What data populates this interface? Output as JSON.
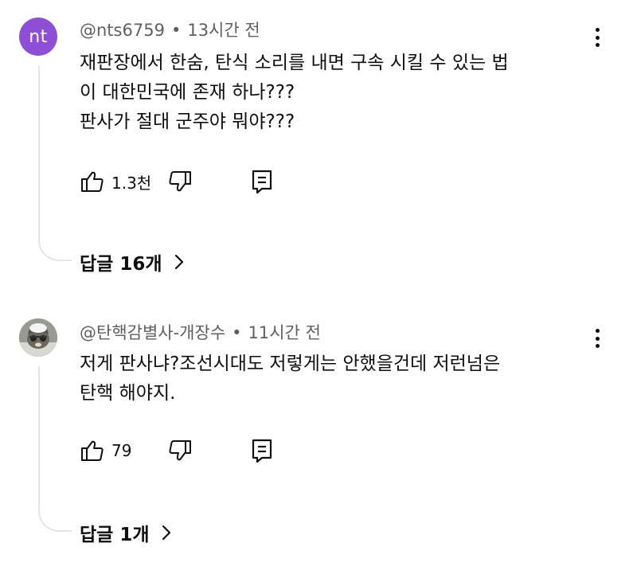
{
  "comments": [
    {
      "avatar_text": "nt",
      "avatar_color": "#8e4fd6",
      "author": "@nts6759",
      "separator": "•",
      "time": "13시간 전",
      "text": "재판장에서 한숨, 탄식 소리를 내면 구속 시킬 수 있는 법\n이 대한민국에 존재 하나???\n판사가 절대 군주야 뭐야???",
      "likes": "1.3천",
      "replies_label": "답글 16개",
      "icons": {
        "like": "thumb-up-icon",
        "dislike": "thumb-down-icon",
        "reply": "reply-icon",
        "more": "more-vert-icon",
        "chevron": "chevron-right-icon"
      }
    },
    {
      "avatar_text": "",
      "avatar_color": "#8a8a80",
      "author": "@탄핵감별사-개장수",
      "separator": "•",
      "time": "11시간 전",
      "text": "저게 판사냐?조선시대도 저렇게는 안했을건데 저런넘은\n탄핵 해야지.",
      "likes": "79",
      "replies_label": "답글 1개",
      "icons": {
        "like": "thumb-up-icon",
        "dislike": "thumb-down-icon",
        "reply": "reply-icon",
        "more": "more-vert-icon",
        "chevron": "chevron-right-icon"
      }
    }
  ]
}
